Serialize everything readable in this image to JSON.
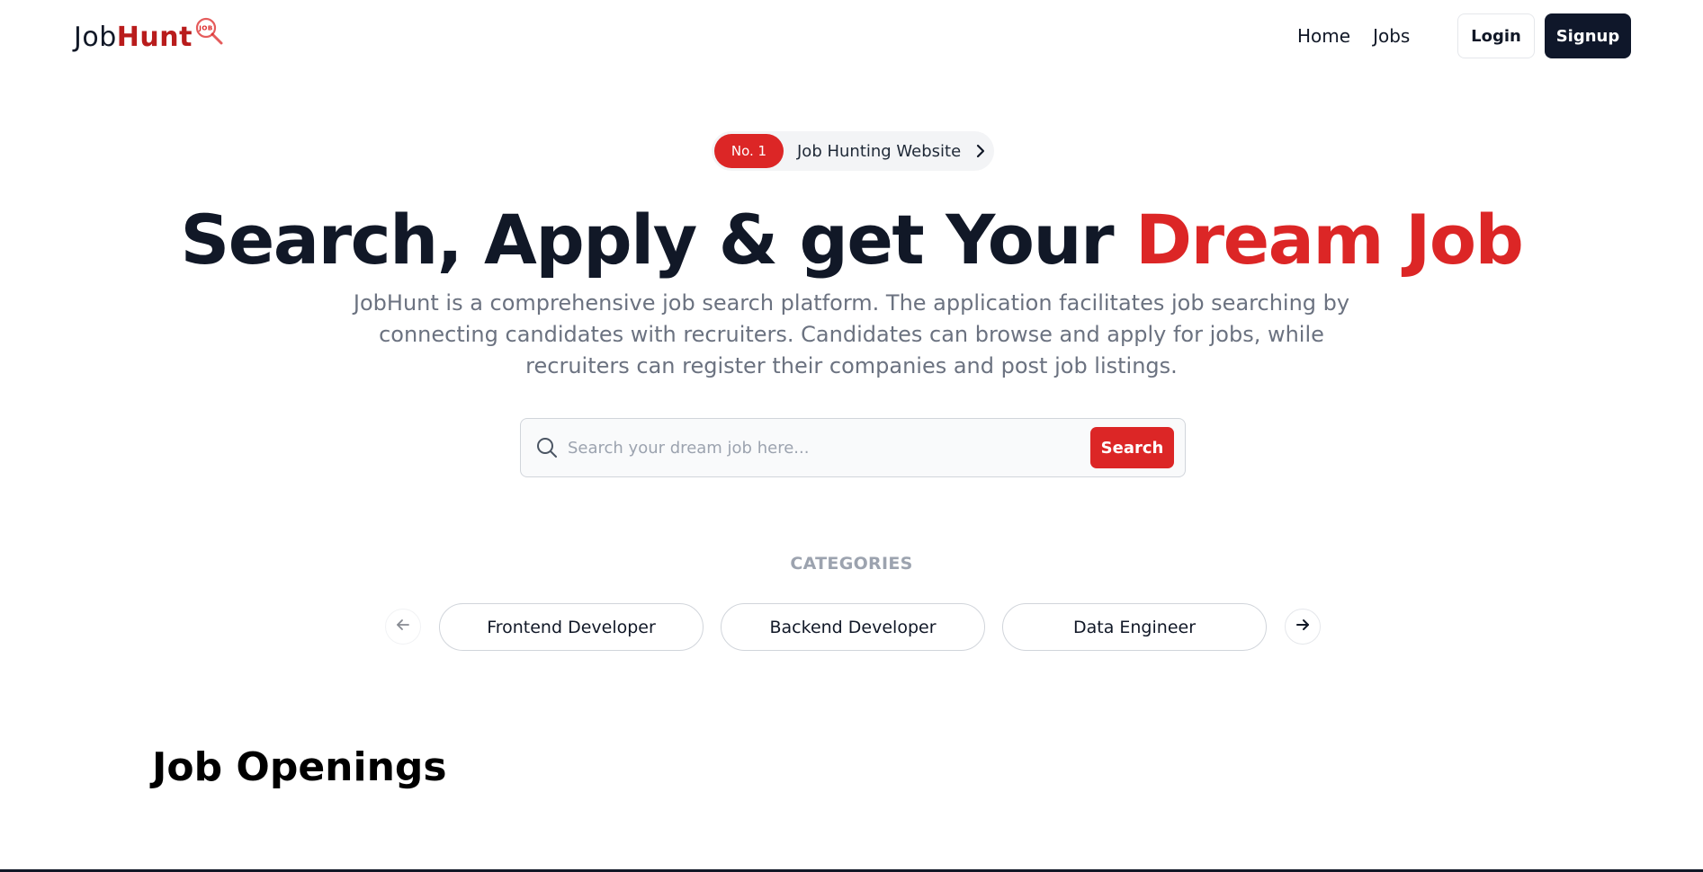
{
  "navbar": {
    "logo_prefix": "Job",
    "logo_suffix": "Hunt",
    "logo_icon_text": "JOB",
    "links": [
      "Home",
      "Jobs"
    ],
    "login_label": "Login",
    "signup_label": "Signup"
  },
  "hero": {
    "badge_tag": "No. 1",
    "badge_text": "Job Hunting Website",
    "title_main": "Search, Apply & get Your ",
    "title_accent": "Dream Job",
    "description": "JobHunt is a comprehensive job search platform. The application facilitates job searching by connecting candidates with recruiters. Candidates can browse and apply for jobs, while recruiters can register their companies and post job listings."
  },
  "search": {
    "placeholder": "Search your dream job here...",
    "value": "",
    "button_label": "Search"
  },
  "categories": {
    "label": "CATEGORIES",
    "items": [
      "Frontend Developer",
      "Backend Developer",
      "Data Engineer"
    ]
  },
  "jobs": {
    "section_title": "Job Openings"
  },
  "colors": {
    "accent": "#dc2626",
    "dark": "#0f172a",
    "muted": "#6b7280"
  },
  "icons": {
    "logo": "magnifier-job-icon",
    "badge": "chevron-right-icon",
    "search": "search-icon",
    "prev": "arrow-left-icon",
    "next": "arrow-right-icon"
  }
}
